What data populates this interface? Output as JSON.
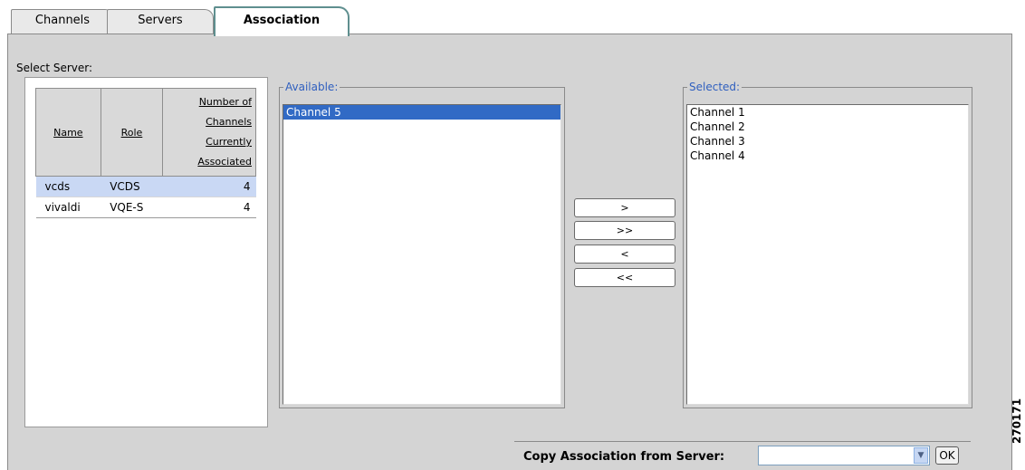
{
  "tabs": [
    {
      "label": "Channels",
      "active": false
    },
    {
      "label": "Servers",
      "active": false
    },
    {
      "label": "Association",
      "active": true
    }
  ],
  "select_server": {
    "label": "Select Server:",
    "columns": [
      "Name",
      "Role",
      "Number of Channels Currently Associated"
    ],
    "rows": [
      {
        "name": "vcds",
        "role": "VCDS",
        "count": "4",
        "selected": true
      },
      {
        "name": "vivaldi",
        "role": "VQE-S",
        "count": "4",
        "selected": false
      }
    ]
  },
  "available": {
    "label": "Available:",
    "items": [
      "Channel 5"
    ],
    "highlighted": "Channel 5"
  },
  "selected_list": {
    "label": "Selected:",
    "items": [
      "Channel 1",
      "Channel 2",
      "Channel 3",
      "Channel 4"
    ]
  },
  "move_buttons": {
    "add": ">",
    "add_all": ">>",
    "remove": "<",
    "remove_all": "<<"
  },
  "copy": {
    "label": "Copy Association from Server:",
    "value": "",
    "ok_label": "OK"
  },
  "figure_id": "270171",
  "colors": {
    "selected_row": "#c9d8f4",
    "highlight": "#316ac5",
    "legend_text": "#2f5fbf"
  }
}
